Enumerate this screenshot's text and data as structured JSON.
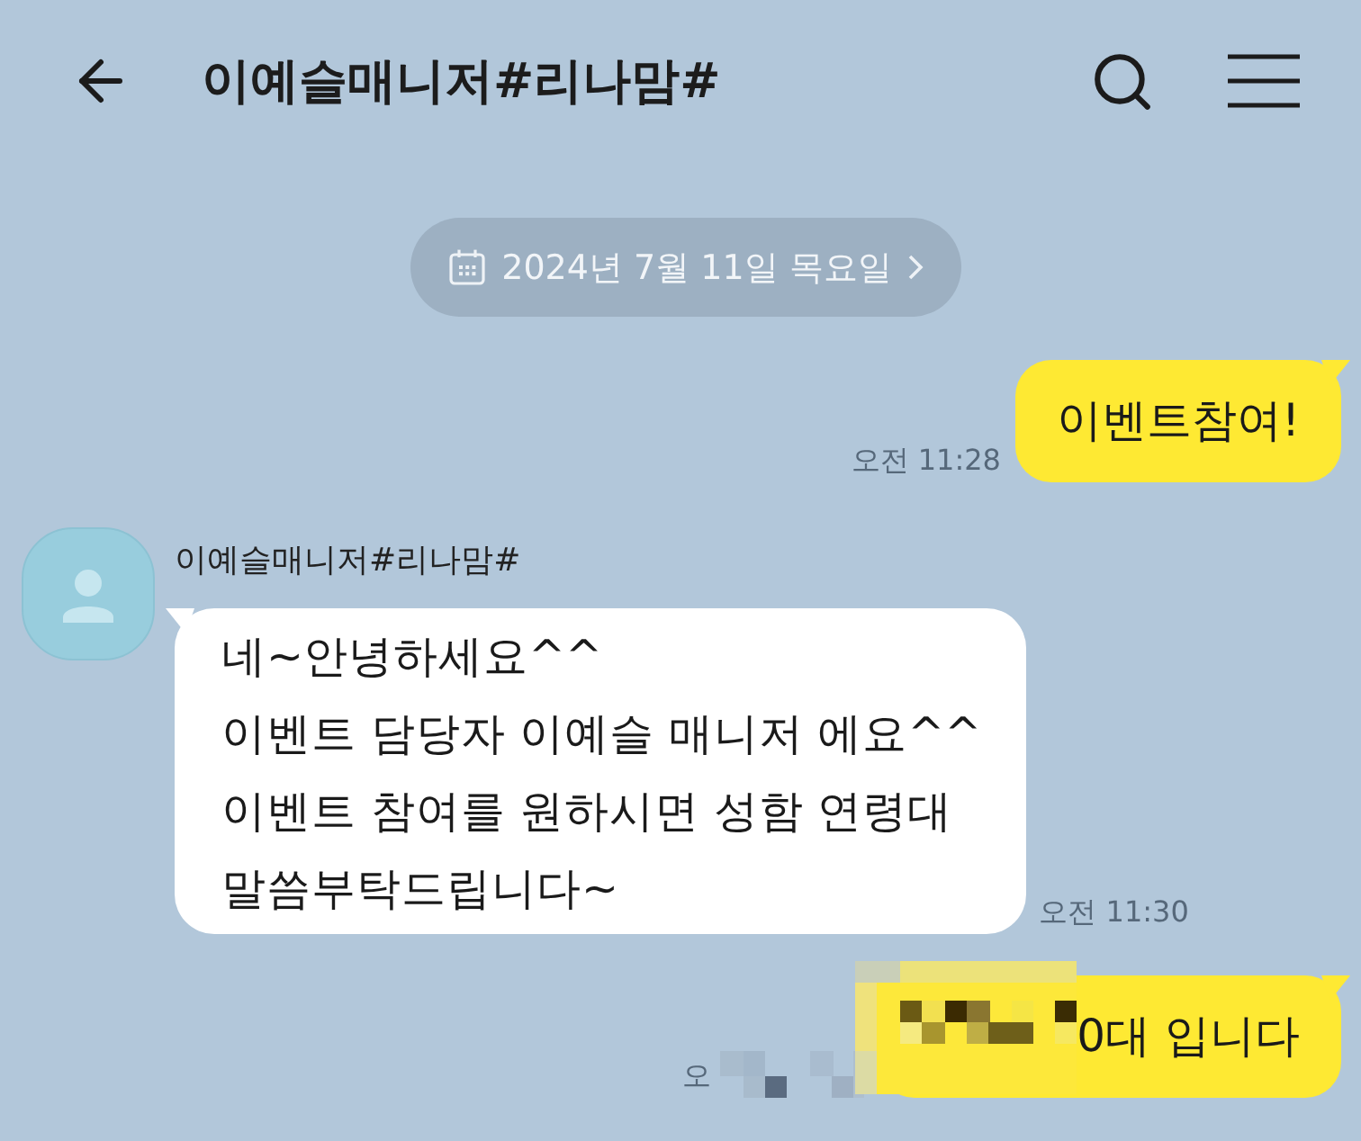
{
  "header": {
    "title": "이예슬매니저#리나맘#"
  },
  "date_divider": {
    "label": "2024년 7월 11일 목요일"
  },
  "messages": [
    {
      "kind": "outgoing",
      "text": "이벤트참여!",
      "time": "오전 11:28",
      "redacted": false
    },
    {
      "kind": "incoming",
      "sender": "이예슬매니저#리나맘#",
      "text": "네~안녕하세요^^\n이벤트 담당자 이예슬 매니저 에요^^\n이벤트 참여를 원하시면 성함 연령대\n말씀부탁드립니다~",
      "time": "오전 11:30"
    },
    {
      "kind": "outgoing",
      "text": "0대 입니다",
      "time": "오",
      "redacted": true
    }
  ]
}
